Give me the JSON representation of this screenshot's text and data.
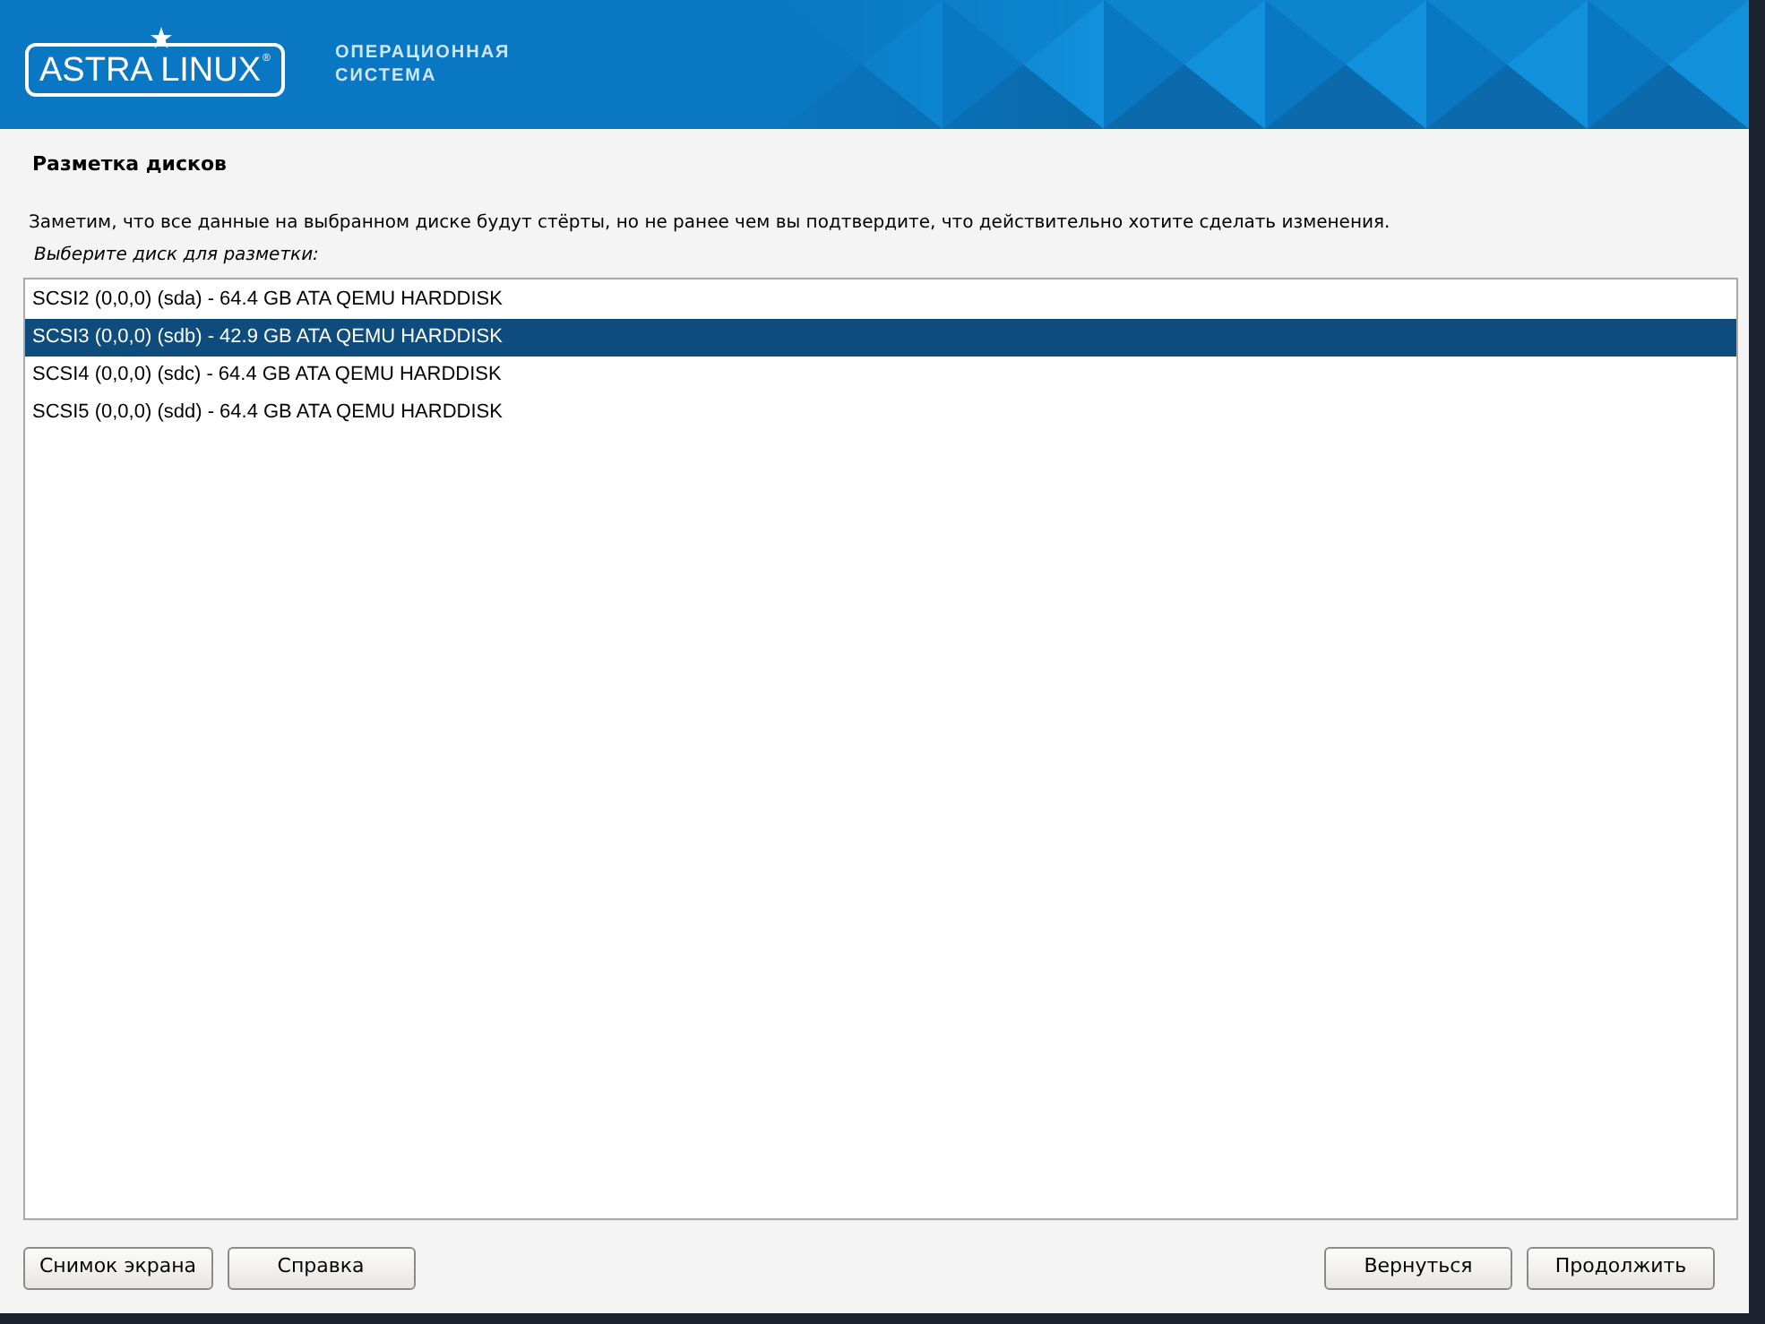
{
  "header": {
    "logo": "ASTRA LINUX",
    "logo_mark": "®",
    "tagline": [
      "ОПЕРАЦИОННАЯ",
      "СИСТЕМА"
    ]
  },
  "title": "Разметка дисков",
  "note": "Заметим, что все данные на выбранном диске будут стёрты, но не ранее чем вы подтвердите, что действительно хотите сделать изменения.",
  "prompt": "Выберите диск для разметки:",
  "disks": [
    {
      "label": "SCSI2 (0,0,0) (sda) - 64.4 GB ATA QEMU HARDDISK",
      "selected": false
    },
    {
      "label": "SCSI3 (0,0,0) (sdb) - 42.9 GB ATA QEMU HARDDISK",
      "selected": true
    },
    {
      "label": "SCSI4 (0,0,0) (sdc) - 64.4 GB ATA QEMU HARDDISK",
      "selected": false
    },
    {
      "label": "SCSI5 (0,0,0) (sdd) - 64.4 GB ATA QEMU HARDDISK",
      "selected": false
    }
  ],
  "buttons_left": [
    "Снимок экрана",
    "Справка"
  ],
  "buttons_right": [
    "Вернуться",
    "Продолжить"
  ]
}
